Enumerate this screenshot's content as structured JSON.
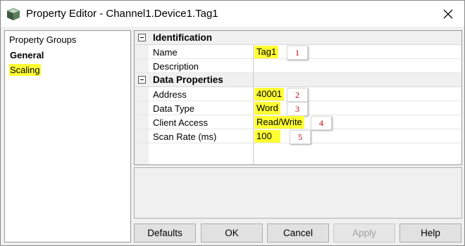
{
  "window": {
    "title": "Property Editor - Channel1.Device1.Tag1"
  },
  "property_groups": {
    "header": "Property Groups",
    "items": [
      {
        "label": "General",
        "bold": true
      },
      {
        "label": "Scaling",
        "highlight": "#ffff33"
      }
    ]
  },
  "grid": {
    "sections": [
      {
        "title": "Identification",
        "expander": "minus",
        "properties": [
          {
            "name": "Name",
            "value": "Tag1",
            "badge": "1"
          },
          {
            "name": "Description",
            "value": ""
          }
        ]
      },
      {
        "title": "Data Properties",
        "expander": "minus",
        "properties": [
          {
            "name": "Address",
            "value": "40001",
            "badge": "2"
          },
          {
            "name": "Data Type",
            "value": "Word",
            "badge": "3"
          },
          {
            "name": "Client Access",
            "value": "Read/Write",
            "badge": "4"
          },
          {
            "name": "Scan Rate (ms)",
            "value": "100",
            "badge": "5"
          }
        ]
      }
    ]
  },
  "buttons": {
    "defaults": "Defaults",
    "ok": "OK",
    "cancel": "Cancel",
    "apply": "Apply",
    "help": "Help"
  },
  "colors": {
    "highlight": "#ffff33",
    "badge_text": "#c00000",
    "window_bg": "#f0f0f0"
  },
  "icons": {
    "app": "tag-cube-icon",
    "close": "close-icon",
    "expander": "collapse-minus-icon"
  }
}
